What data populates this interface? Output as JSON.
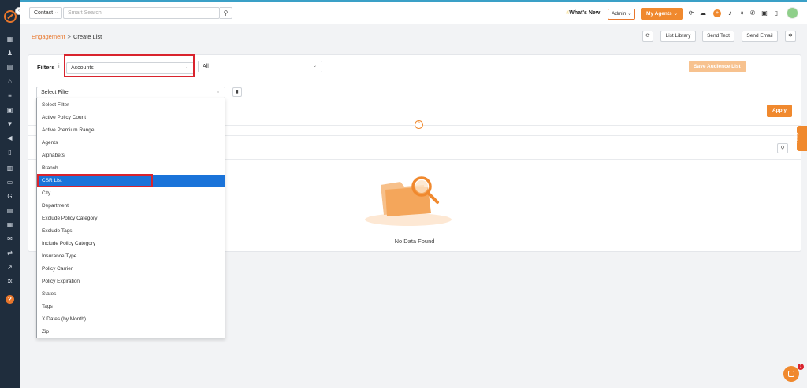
{
  "topbar": {
    "contact_select": "Contact",
    "search_placeholder": "Smart Search",
    "whats_new": "What's New",
    "admin_select": "Admin",
    "my_agents": "My Agents"
  },
  "breadcrumb": {
    "parent": "Engagement",
    "separator": ">",
    "current": "Create List"
  },
  "header_buttons": {
    "list_library": "List Library",
    "send_text": "Send Text",
    "send_email": "Send Email"
  },
  "filters": {
    "label": "Filters",
    "info": "i",
    "accounts_value": "Accounts",
    "all_value": "All",
    "save_audience": "Save Audience List",
    "select_filter_value": "Select Filter",
    "apply": "Apply"
  },
  "results": {
    "empty_text": "No Data Found"
  },
  "dropdown": {
    "items": [
      "Select Filter",
      "Active Policy Count",
      "Active Premium Range",
      "Agents",
      "Alphabets",
      "Branch",
      "CSR List",
      "City",
      "Department",
      "Exclude Policy Category",
      "Exclude Tags",
      "Include Policy Category",
      "Insurance Type",
      "Policy Carrier",
      "Policy Expiration",
      "States",
      "Tags",
      "X Dates (by Month)",
      "Zip"
    ],
    "selected": "CSR List"
  },
  "help_tab": "Help",
  "chat_badge": "1",
  "colors": {
    "accent": "#f0892e",
    "sidebar": "#1f2d3d",
    "highlight_box": "#d9232d",
    "selected_item": "#1a73d9"
  }
}
